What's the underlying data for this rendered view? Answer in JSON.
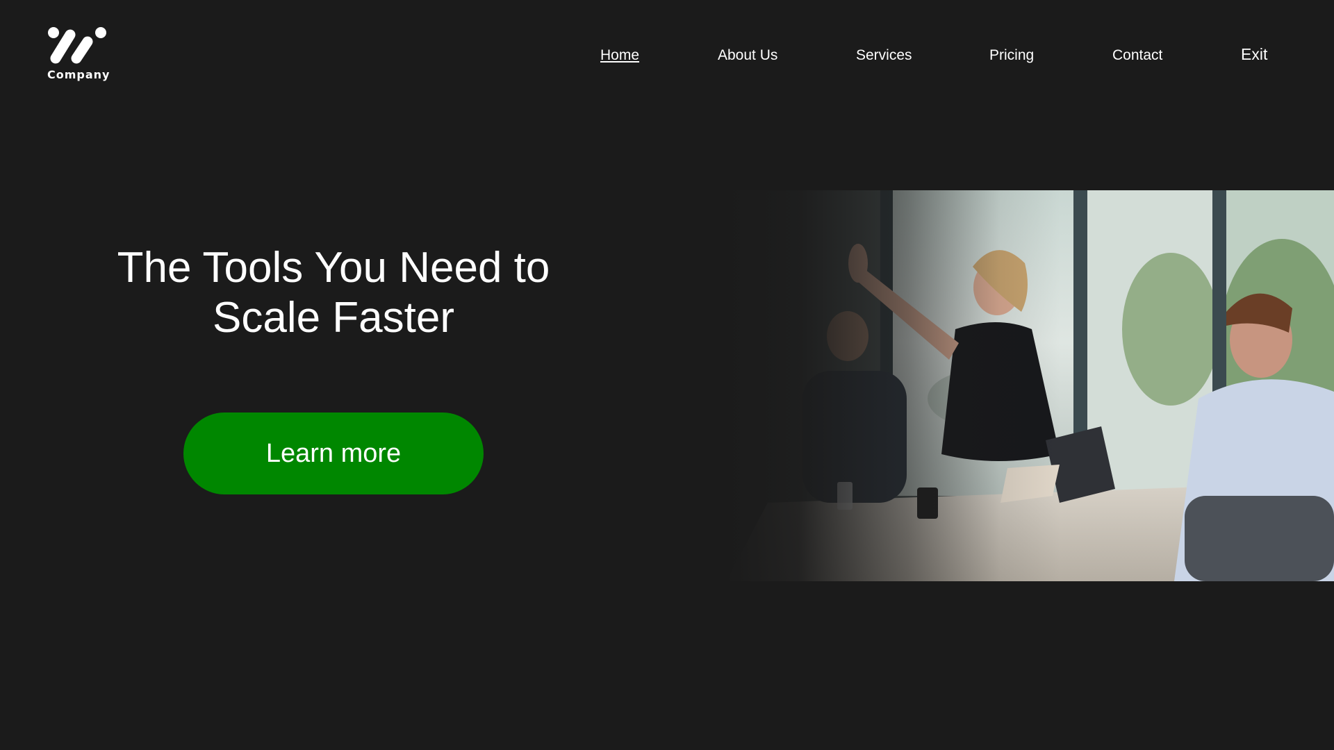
{
  "brand": {
    "name": "Company",
    "logo_icon": "slanted-bars-logo-icon"
  },
  "nav": {
    "items": [
      {
        "label": "Home",
        "active": true
      },
      {
        "label": "About Us",
        "active": false
      },
      {
        "label": "Services",
        "active": false
      },
      {
        "label": "Pricing",
        "active": false
      },
      {
        "label": "Contact",
        "active": false
      },
      {
        "label": "Exit",
        "active": false
      }
    ]
  },
  "hero": {
    "title_line1": "The Tools You Need to",
    "title_line2": "Scale Faster",
    "cta_label": "Learn more",
    "image_subject": "office team high-five photo"
  },
  "colors": {
    "background": "#1b1b1b",
    "text": "#ffffff",
    "cta": "#008700"
  }
}
